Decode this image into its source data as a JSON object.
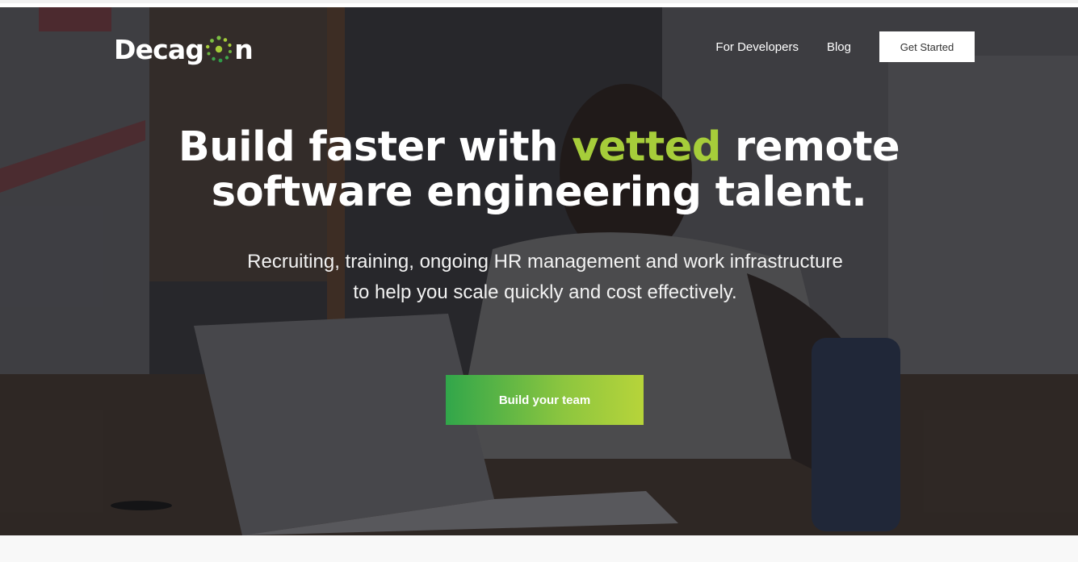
{
  "brand": {
    "name": "Decagon",
    "name_prefix": "Decag",
    "name_suffix": "n"
  },
  "nav": {
    "items": [
      {
        "label": "For Developers"
      },
      {
        "label": "Blog"
      }
    ],
    "cta_label": "Get Started"
  },
  "hero": {
    "headline_part1": "Build faster with ",
    "headline_highlight": "vetted",
    "headline_part2": " remote",
    "headline_line2": "software engineering talent.",
    "subheading_line1": "Recruiting, training, ongoing HR management and work infrastructure",
    "subheading_line2": "to help you scale quickly and cost effectively.",
    "cta_label": "Build your team"
  },
  "colors": {
    "accent": "#a6cd3a",
    "cta_gradient_start": "#31a64a",
    "cta_gradient_end": "#b7d43a",
    "overlay": "#18181c"
  },
  "icons": [
    "decagon-ring-logo-icon"
  ]
}
